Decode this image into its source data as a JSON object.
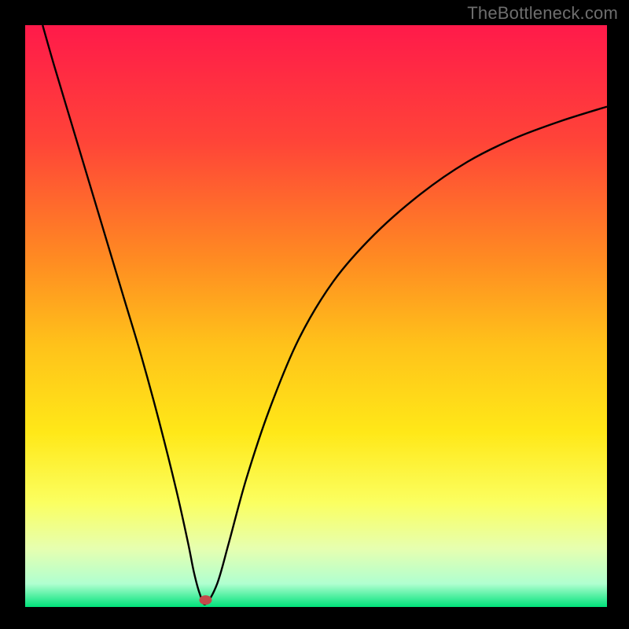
{
  "watermark": "TheBottleneck.com",
  "chart_data": {
    "type": "line",
    "title": "",
    "xlabel": "",
    "ylabel": "",
    "xlim": [
      0,
      100
    ],
    "ylim": [
      0,
      100
    ],
    "legend": false,
    "grid": false,
    "annotations": [],
    "background": {
      "type": "vertical-gradient",
      "stops": [
        {
          "offset": 0,
          "color": "#ff1a4a"
        },
        {
          "offset": 20,
          "color": "#ff4438"
        },
        {
          "offset": 40,
          "color": "#ff8a22"
        },
        {
          "offset": 55,
          "color": "#ffc21a"
        },
        {
          "offset": 70,
          "color": "#ffe818"
        },
        {
          "offset": 82,
          "color": "#fbff60"
        },
        {
          "offset": 90,
          "color": "#e6ffb0"
        },
        {
          "offset": 96,
          "color": "#b0ffd0"
        },
        {
          "offset": 100,
          "color": "#00e27a"
        }
      ]
    },
    "marker": {
      "x": 31,
      "y": 1.2,
      "color": "#c34a4a"
    },
    "series": [
      {
        "name": "curve",
        "color": "#000000",
        "x": [
          3,
          5,
          8,
          11,
          14,
          17,
          20,
          23,
          26,
          28,
          29,
          30,
          31,
          33,
          35,
          38,
          42,
          47,
          53,
          60,
          68,
          76,
          84,
          92,
          100
        ],
        "y": [
          100,
          93,
          83,
          73,
          63,
          53,
          43,
          32,
          20,
          11,
          6,
          2.3,
          0.5,
          4,
          11,
          22,
          34,
          46,
          56,
          64,
          71,
          76.5,
          80.5,
          83.5,
          86
        ]
      }
    ]
  }
}
